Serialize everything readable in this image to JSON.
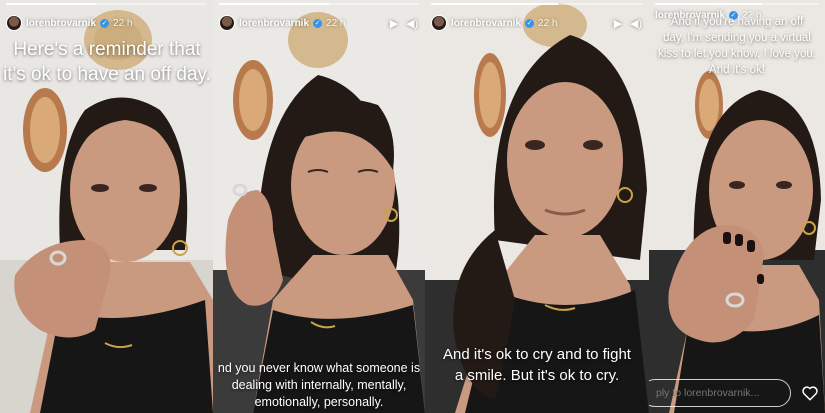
{
  "panels": [
    {
      "username": "lorenbrovarnik",
      "time_ago": "22 h",
      "text_lines": [
        "Here's a reminder that",
        "it's ok to have an off day."
      ]
    },
    {
      "username": "lorenbrovarnik",
      "time_ago": "22 h",
      "text_lines": [
        "nd you never know what someone is",
        "dealing with internally, mentally,",
        "emotionally, personally."
      ]
    },
    {
      "username": "lorenbrovarnik",
      "time_ago": "22 h",
      "text_lines": [
        "And it's ok to cry and to fight",
        "a smile. But it's ok to cry."
      ]
    },
    {
      "username": "lorenbrovarnik",
      "time_ago": "22 h",
      "text_lines": [
        "And if you're having an off",
        "day, I'm sending you a virtual",
        "kiss to let you know, I love you.",
        "And it's ok!"
      ],
      "reply_placeholder": "ply to lorenbrovarnik..."
    }
  ],
  "icons": {
    "play": "play-icon",
    "volume": "volume-icon",
    "more": "more-icon",
    "heart": "heart-icon",
    "verified": "verified-badge-icon"
  },
  "colors": {
    "verified": "#3897f0",
    "wall": "#ece9e4",
    "tank_top": "#161616",
    "skin": "#c99a80",
    "hair": "#231a16"
  }
}
